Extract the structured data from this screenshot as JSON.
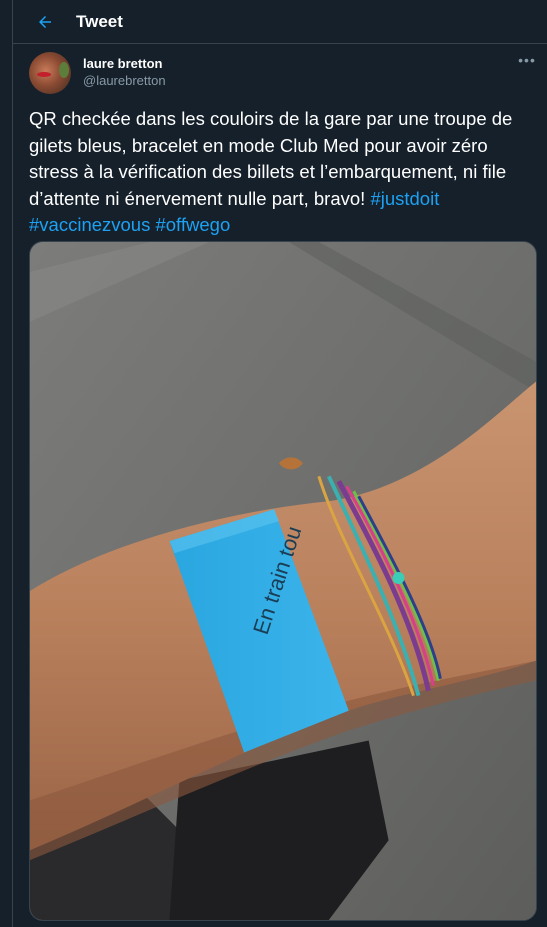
{
  "header": {
    "title": "Tweet"
  },
  "tweet": {
    "author": {
      "display_name": "laure bretton",
      "handle": "@laurebretton"
    },
    "more_label": "•••",
    "text_parts": [
      "QR checkée dans les couloirs de la gare par une troupe de gilets bleus, bracelet en mode Club Med pour avoir zéro stress à la vérification des billets et l’embarquement, ni file d’attente ni énervement nulle part, bravo! ",
      " ",
      " "
    ],
    "hashtags": [
      "#justdoit",
      "#vaccinezvous",
      "#offwego"
    ],
    "media": {
      "wristband_text": "En train tou"
    }
  },
  "colors": {
    "background": "#15202b",
    "accent": "#1da1f2",
    "border": "#38444d",
    "secondary_text": "#8899a6"
  }
}
